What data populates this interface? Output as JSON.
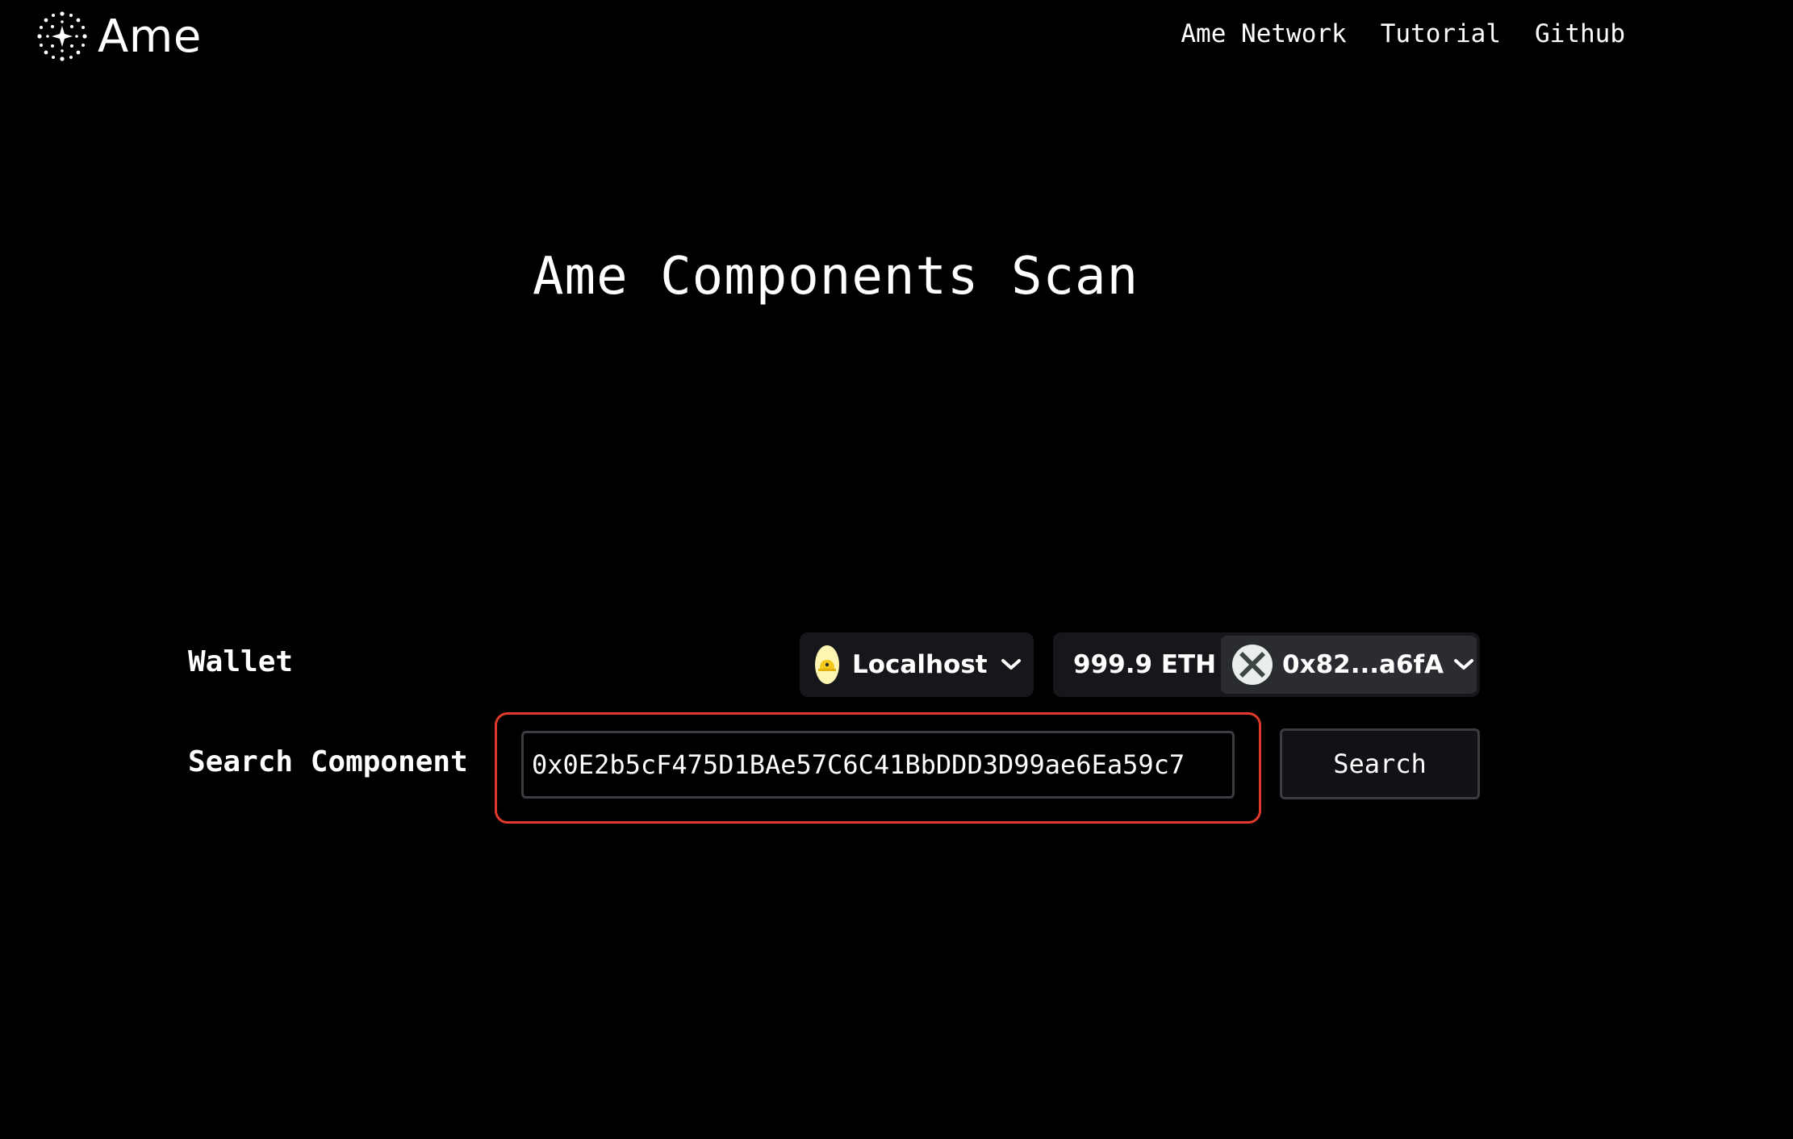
{
  "header": {
    "logo_text": "Ame",
    "nav": [
      {
        "label": "Ame Network"
      },
      {
        "label": "Tutorial"
      },
      {
        "label": "Github"
      }
    ]
  },
  "main": {
    "title": "Ame Components Scan",
    "wallet": {
      "label": "Wallet",
      "chain": "Localhost",
      "balance": "999.9 ETH",
      "account": "0x82...a6fA"
    },
    "search": {
      "label": "Search Component",
      "input_value": "0x0E2b5cF475D1BAe57C6C41BbDDD3D99ae6Ea59c7",
      "button_label": "Search"
    }
  },
  "colors": {
    "background": "#000000",
    "highlight": "#e0392b",
    "chain_icon": "#fff5b3"
  }
}
